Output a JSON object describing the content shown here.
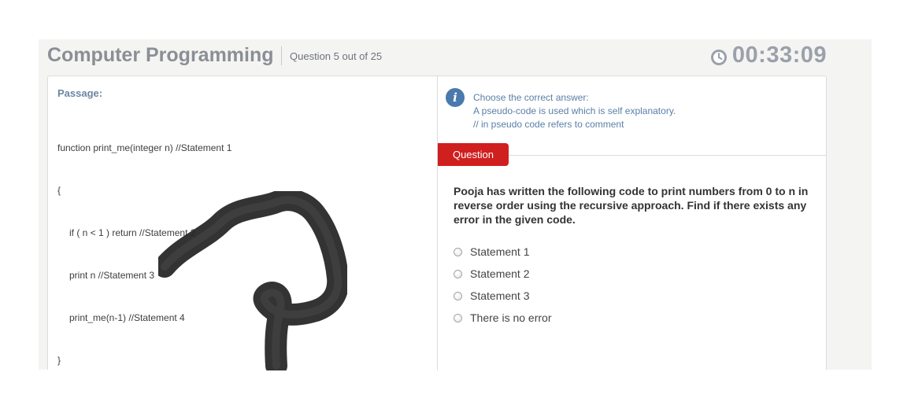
{
  "header": {
    "title": "Computer Programming",
    "question_count": "Question 5 out of 25",
    "timer": "00:33:09",
    "timer_icon": "clock-icon"
  },
  "passage": {
    "title": "Passage:",
    "code_lines": [
      "function print_me(integer n) //Statement 1",
      "{",
      "if ( n < 1 ) return //Statement 2",
      "print n //Statement 3",
      "print_me(n-1) //Statement 4",
      "}"
    ]
  },
  "instructions": {
    "icon": "info-icon",
    "lines": [
      "Choose the correct answer:",
      "A pseudo-code is used which is self explanatory.",
      "// in pseudo code refers to comment"
    ]
  },
  "question": {
    "tab_label": "Question",
    "text": "Pooja has written the following code to print numbers from 0 to n in reverse order using the recursive approach. Find if there exists any error in the given code.",
    "options": [
      "Statement 1",
      "Statement 2",
      "Statement 3",
      "There is no error"
    ]
  },
  "colors": {
    "accent_red": "#cf1f1f",
    "info_blue": "#4a79ad",
    "title_gray": "#8a8f96"
  }
}
